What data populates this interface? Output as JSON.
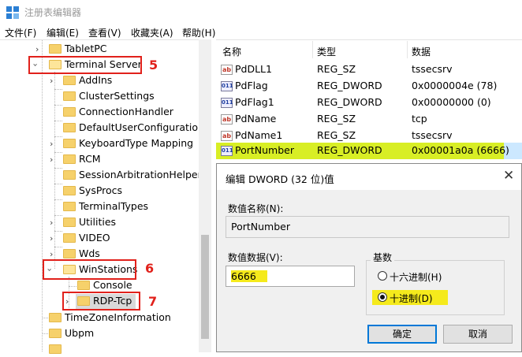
{
  "window": {
    "title": "注册表编辑器"
  },
  "menu": [
    "文件(F)",
    "编辑(E)",
    "查看(V)",
    "收藏夹(A)",
    "帮助(H)"
  ],
  "tree": {
    "items": [
      {
        "label": "TabletPC",
        "expand": "collapsed"
      },
      {
        "label": "Terminal Server",
        "expand": "expanded",
        "step": "5"
      },
      {
        "label": "AddIns",
        "expand": "collapsed"
      },
      {
        "label": "ClusterSettings",
        "expand": "none"
      },
      {
        "label": "ConnectionHandler",
        "expand": "none"
      },
      {
        "label": "DefaultUserConfiguration",
        "expand": "none"
      },
      {
        "label": "KeyboardType Mapping",
        "expand": "collapsed"
      },
      {
        "label": "RCM",
        "expand": "collapsed"
      },
      {
        "label": "SessionArbitrationHelper",
        "expand": "none"
      },
      {
        "label": "SysProcs",
        "expand": "none"
      },
      {
        "label": "TerminalTypes",
        "expand": "none"
      },
      {
        "label": "Utilities",
        "expand": "collapsed"
      },
      {
        "label": "VIDEO",
        "expand": "collapsed"
      },
      {
        "label": "Wds",
        "expand": "collapsed"
      },
      {
        "label": "WinStations",
        "expand": "expanded",
        "step": "6"
      },
      {
        "label": "Console",
        "expand": "none"
      },
      {
        "label": "RDP-Tcp",
        "expand": "collapsed",
        "step": "7",
        "selected": true
      },
      {
        "label": "TimeZoneInformation",
        "expand": "none"
      },
      {
        "label": "Ubpm",
        "expand": "none"
      }
    ]
  },
  "list": {
    "columns": [
      "名称",
      "类型",
      "数据"
    ],
    "rows": [
      {
        "icon": "string-value-icon",
        "name": "PdDLL1",
        "type": "REG_SZ",
        "data": "tssecsrv"
      },
      {
        "icon": "dword-value-icon",
        "name": "PdFlag",
        "type": "REG_DWORD",
        "data": "0x0000004e (78)"
      },
      {
        "icon": "dword-value-icon",
        "name": "PdFlag1",
        "type": "REG_DWORD",
        "data": "0x00000000 (0)"
      },
      {
        "icon": "string-value-icon",
        "name": "PdName",
        "type": "REG_SZ",
        "data": "tcp"
      },
      {
        "icon": "string-value-icon",
        "name": "PdName1",
        "type": "REG_SZ",
        "data": "tssecsrv"
      },
      {
        "icon": "dword-value-icon",
        "name": "PortNumber",
        "type": "REG_DWORD",
        "data": "0x00001a0a (6666)",
        "highlighted": true
      }
    ]
  },
  "dialog": {
    "title": "编辑 DWORD (32 位)值",
    "name_label": "数值名称(N):",
    "name_value": "PortNumber",
    "data_label": "数值数据(V):",
    "data_value": "6666",
    "base_label": "基数",
    "base_options": [
      {
        "label": "十六进制(H)",
        "checked": false
      },
      {
        "label": "十进制(D)",
        "checked": true
      }
    ],
    "ok": "确定",
    "cancel": "取消",
    "close_icon": "close-icon"
  },
  "colors": {
    "annotation_red": "#e1211b",
    "highlight_lime": "#d8ee25",
    "selection_blue": "#cce8ff",
    "accent": "#0078d7"
  }
}
